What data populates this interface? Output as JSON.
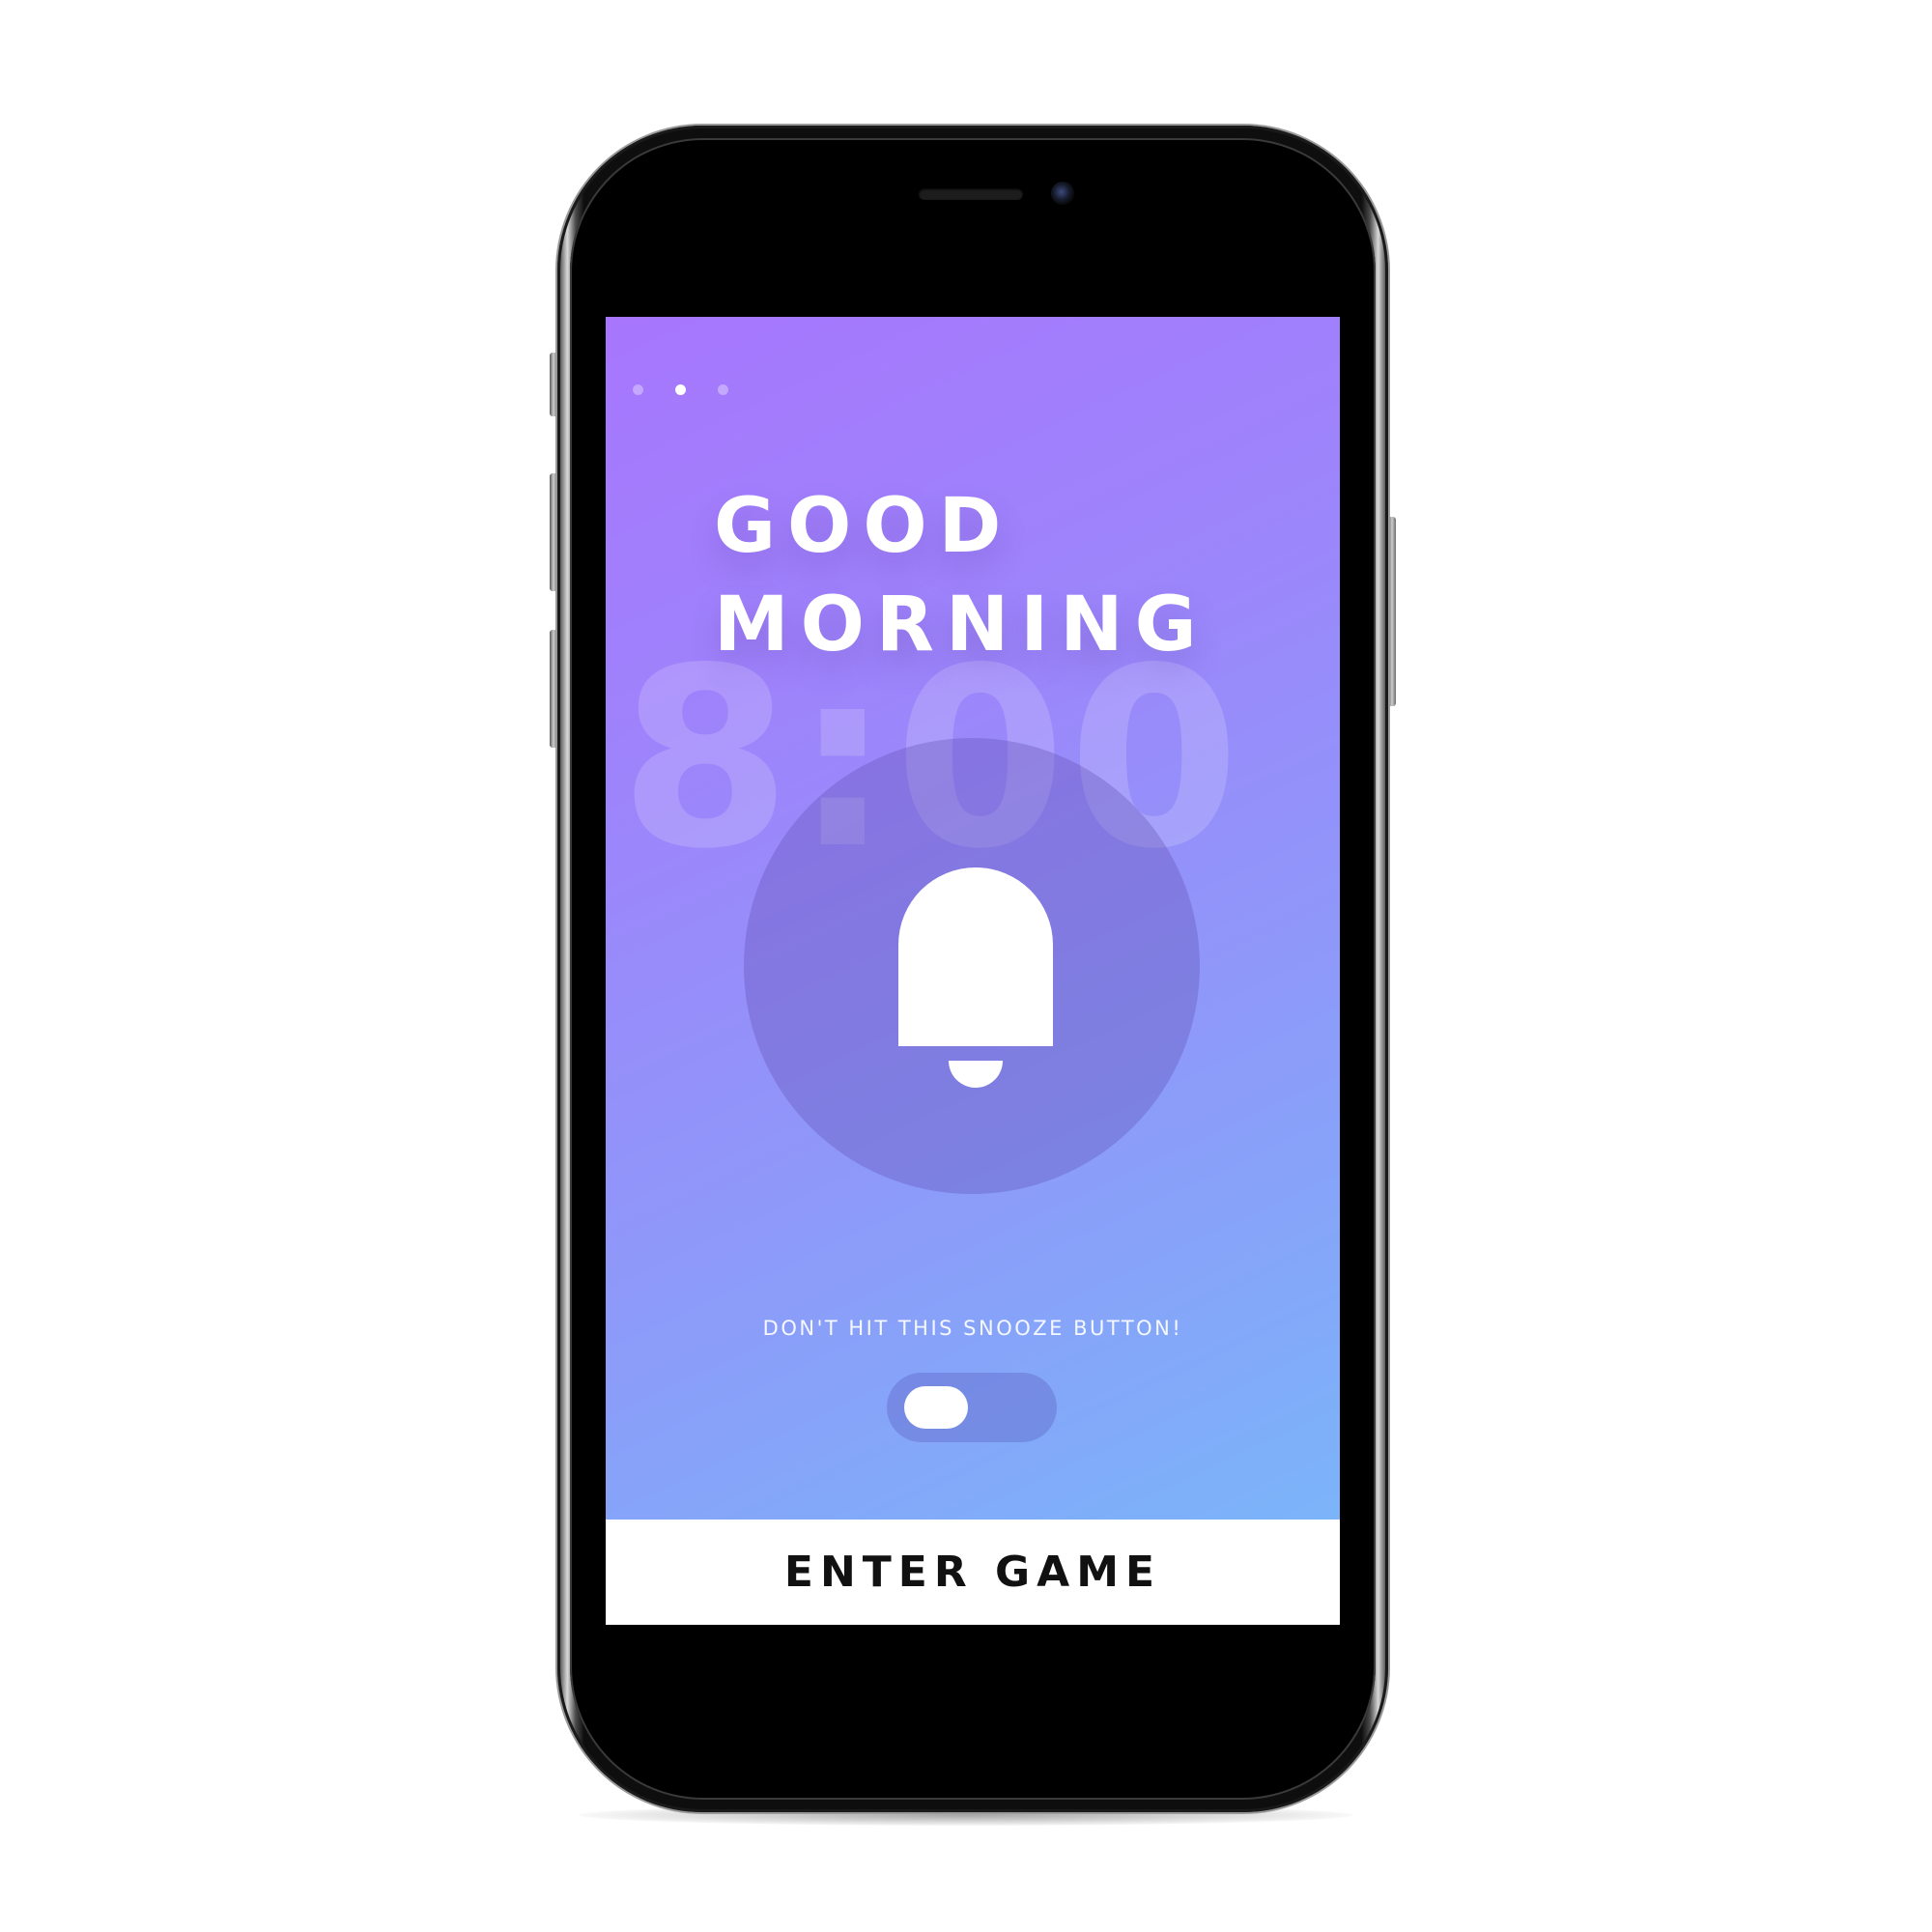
{
  "screen": {
    "page_indicator": {
      "count": 3,
      "active_index": 1
    },
    "greeting": {
      "line1": "GOOD",
      "line2": "MORNING"
    },
    "alarm_time": "8:00",
    "bell": {
      "icon": "bell-icon"
    },
    "snooze": {
      "label": "DON'T HIT THIS SNOOZE BUTTON!",
      "toggle_on": false
    },
    "cta": {
      "label": "ENTER GAME"
    }
  },
  "colors": {
    "gradient_start": "#a776fd",
    "gradient_end": "#7bb4f9",
    "button_bg": "#ffffff",
    "button_text": "#111111"
  }
}
